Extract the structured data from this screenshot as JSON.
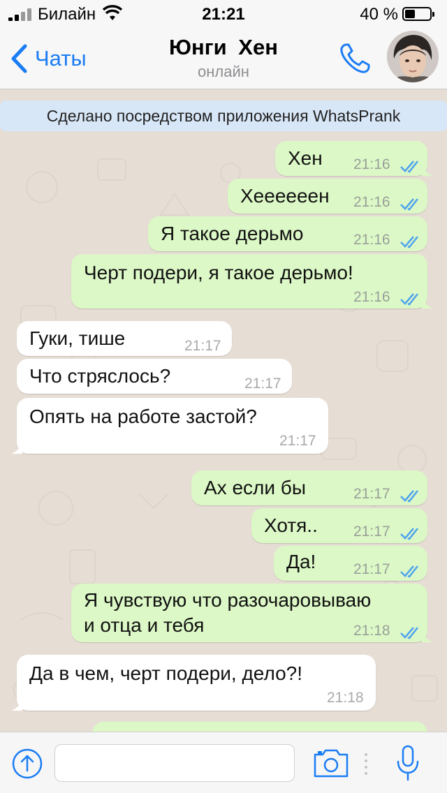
{
  "status_bar": {
    "carrier": "Билайн",
    "time": "21:21",
    "battery_percent": "40 %",
    "battery_level": 0.4
  },
  "nav": {
    "back_label": "Чаты",
    "contact_name": "Юнги  Хен",
    "contact_status": "онлайн"
  },
  "banner": {
    "text": "Сделано посредством приложения WhatsPrank"
  },
  "messages": [
    {
      "direction": "out",
      "text": "Хен",
      "time": "21:16",
      "read": true
    },
    {
      "direction": "out",
      "text": "Хеееееен",
      "time": "21:16",
      "read": true
    },
    {
      "direction": "out",
      "text": "Я такое дерьмо",
      "time": "21:16",
      "read": true
    },
    {
      "direction": "out",
      "text": "Черт подери, я такое дерьмо!",
      "time": "21:16",
      "read": true
    },
    {
      "direction": "in",
      "text": "Гуки, тише",
      "time": "21:17"
    },
    {
      "direction": "in",
      "text": "Что стряслось?",
      "time": "21:17"
    },
    {
      "direction": "in",
      "text": "Опять на работе застой?",
      "time": "21:17"
    },
    {
      "direction": "out",
      "text": "Ах если бы",
      "time": "21:17",
      "read": true
    },
    {
      "direction": "out",
      "text": "Хотя..",
      "time": "21:17",
      "read": true
    },
    {
      "direction": "out",
      "text": "Да!",
      "time": "21:17",
      "read": true
    },
    {
      "direction": "out",
      "text_line1": "Я чувствую что разочаровываю",
      "text_line2": "и отца и тебя",
      "time": "21:18",
      "read": true
    },
    {
      "direction": "in",
      "text": "Да в чем, черт подери, дело?!",
      "time": "21:18"
    }
  ],
  "input_bar": {
    "placeholder": ""
  },
  "colors": {
    "accent": "#1a7cf4",
    "outgoing_bubble": "#dcf8c6",
    "incoming_bubble": "#ffffff",
    "read_ticks": "#4fa3ef",
    "chat_background": "#e6ded5"
  },
  "icons": [
    "signal-icon",
    "wifi-icon",
    "battery-icon",
    "back-chevron-icon",
    "phone-icon",
    "avatar",
    "plus-icon",
    "camera-icon",
    "mic-icon",
    "read-ticks-icon"
  ]
}
